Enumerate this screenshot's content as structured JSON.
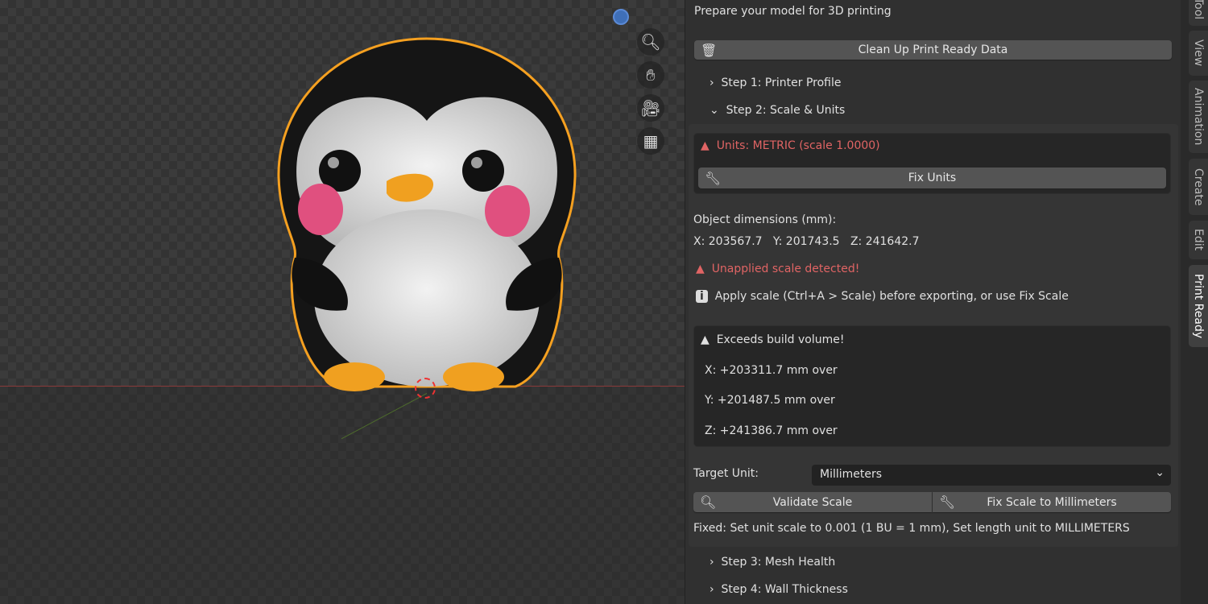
{
  "viewport": {
    "nav_icons": [
      "zoom-icon",
      "hand-pan-icon",
      "camera-icon",
      "grid-icon"
    ]
  },
  "panel": {
    "subtitle": "Prepare your model for 3D printing",
    "cleanup_label": "Clean Up Print Ready Data",
    "steps": [
      {
        "label": "Step 1: Printer Profile",
        "expanded": false
      },
      {
        "label": "Step 2: Scale & Units",
        "expanded": true
      },
      {
        "label": "Step 3: Mesh Health",
        "expanded": false
      },
      {
        "label": "Step 4: Wall Thickness",
        "expanded": false
      }
    ],
    "units_warning": "Units: METRIC (scale 1.0000)",
    "fix_units_label": "Fix Units",
    "dims_label": "Object dimensions (mm):",
    "dims": {
      "x": "X: 203567.7",
      "y": "Y: 201743.5",
      "z": "Z: 241642.7"
    },
    "scale_warning": "Unapplied scale detected!",
    "scale_info": "Apply scale (Ctrl+A > Scale) before exporting, or use Fix Scale",
    "build_warning": "Exceeds build volume!",
    "over": [
      "X: +203311.7 mm over",
      "Y: +201487.5 mm over",
      "Z: +241386.7 mm over"
    ],
    "target_unit_label": "Target Unit:",
    "target_unit_value": "Millimeters",
    "validate_label": "Validate Scale",
    "fix_scale_label": "Fix Scale to Millimeters",
    "fixed_msg": "Fixed: Set unit scale to 0.001 (1 BU = 1 mm), Set length unit to MILLIMETERS"
  },
  "tabs": [
    "Tool",
    "View",
    "Animation",
    "Create",
    "Edit",
    "Print Ready"
  ],
  "colors": {
    "warning": "#e06464",
    "selection": "#f5a020",
    "accent": "#3f6fb8"
  }
}
